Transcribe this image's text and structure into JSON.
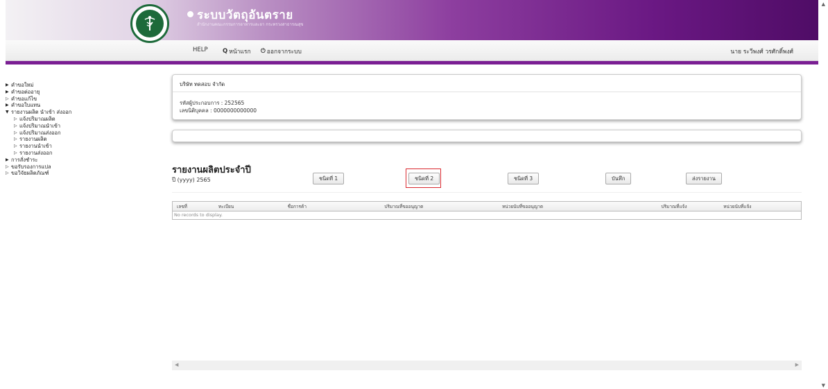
{
  "header": {
    "title": "ระบบวัตถุอันตราย",
    "subtitle": "สำนักงานคณะกรรมการอาหารและยา กระทรวงสาธารณสุข"
  },
  "nav": {
    "help": "HELP",
    "home": "หน้าแรก",
    "logout": "ออกจากระบบ",
    "user": "นาย ระวีพงศ์ วรศักดิ์พงศ์"
  },
  "sidebar": {
    "items": [
      {
        "label": "คำขอใหม่",
        "arrow": "▶",
        "level": 0
      },
      {
        "label": "คำขอต่ออายุ",
        "arrow": "▶",
        "level": 0
      },
      {
        "label": "คำขอแก้ไข",
        "arrow": "▷",
        "level": 0
      },
      {
        "label": "คำขอใบแทน",
        "arrow": "▶",
        "level": 0
      },
      {
        "label": "รายงานผลิต นำเข้า ส่งออก",
        "arrow": "▼",
        "level": 0
      },
      {
        "label": "แจ้งปริมาณผลิต",
        "arrow": "▷",
        "level": 1
      },
      {
        "label": "แจ้งปริมาณนำเข้า",
        "arrow": "▷",
        "level": 1
      },
      {
        "label": "แจ้งปริมาณส่งออก",
        "arrow": "▷",
        "level": 1
      },
      {
        "label": "รายงานผลิต",
        "arrow": "▷",
        "level": 1
      },
      {
        "label": "รายงานนำเข้า",
        "arrow": "▷",
        "level": 1
      },
      {
        "label": "รายงานส่งออก",
        "arrow": "▷",
        "level": 1
      },
      {
        "label": "การสั่งชำระ",
        "arrow": "▶",
        "level": 0
      },
      {
        "label": "ขอรับรองการแปล",
        "arrow": "▷",
        "level": 0
      },
      {
        "label": "ขอวิจัยผลิตภัณฑ์",
        "arrow": "▷",
        "level": 0
      }
    ]
  },
  "company": {
    "name": "บริษัท ทดสอบ จำกัด",
    "operator_label": "รหัสผู้ประกอบการ : 252565",
    "tax_label": "เลขนิติบุคคล : 0000000000000"
  },
  "report": {
    "title": "รายงานผลิตประจำปี",
    "year_label": "ปี (yyyy) 2565"
  },
  "buttons": {
    "type1": "ชนิดที่ 1",
    "type2": "ชนิดที่ 2",
    "type3": "ชนิดที่ 3",
    "save": "บันทึก",
    "send": "ส่งรายงาน"
  },
  "table": {
    "columns": [
      "เลขที่",
      "ทะเบียน",
      "ชื่อการค้า",
      "ปริมาณที่ขออนุญาต",
      "หน่วยนับที่ขออนุญาต",
      "ปริมาณที่แจ้ง",
      "หน่วยนับที่แจ้ง"
    ],
    "empty_text": "No records to display."
  },
  "colors": {
    "accent": "#7a1f93",
    "highlight": "#d9272e"
  }
}
